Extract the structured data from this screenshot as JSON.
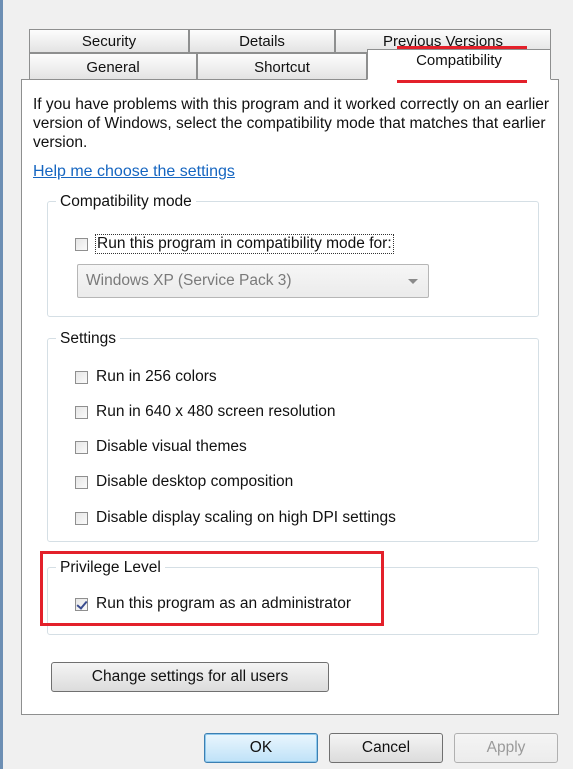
{
  "tabs": {
    "top_row": [
      "Security",
      "Details",
      "Previous Versions"
    ],
    "bottom_row": [
      "General",
      "Shortcut",
      "Compatibility"
    ],
    "active": "Compatibility"
  },
  "intro_text": "If you have problems with this program and it worked correctly on an earlier version of Windows, select the compatibility mode that matches that earlier version.",
  "help_link": "Help me choose the settings",
  "compatibility_mode": {
    "label": "Compatibility mode",
    "checkbox_label": "Run this program in compatibility mode for:",
    "checked": false,
    "selected_os": "Windows XP (Service Pack 3)"
  },
  "settings": {
    "label": "Settings",
    "options": [
      {
        "label": "Run in 256 colors",
        "checked": false
      },
      {
        "label": "Run in 640 x 480 screen resolution",
        "checked": false
      },
      {
        "label": "Disable visual themes",
        "checked": false
      },
      {
        "label": "Disable desktop composition",
        "checked": false
      },
      {
        "label": "Disable display scaling on high DPI settings",
        "checked": false
      }
    ]
  },
  "privilege_level": {
    "label": "Privilege Level",
    "checkbox_label": "Run this program as an administrator",
    "checked": true
  },
  "change_settings_button": "Change settings for all users",
  "footer_buttons": {
    "ok": "OK",
    "cancel": "Cancel",
    "apply": "Apply"
  },
  "colors": {
    "highlight": "#e3202a",
    "link": "#1565c0",
    "dialog_background": "#f0f0f0",
    "panel_background": "#ffffff"
  }
}
